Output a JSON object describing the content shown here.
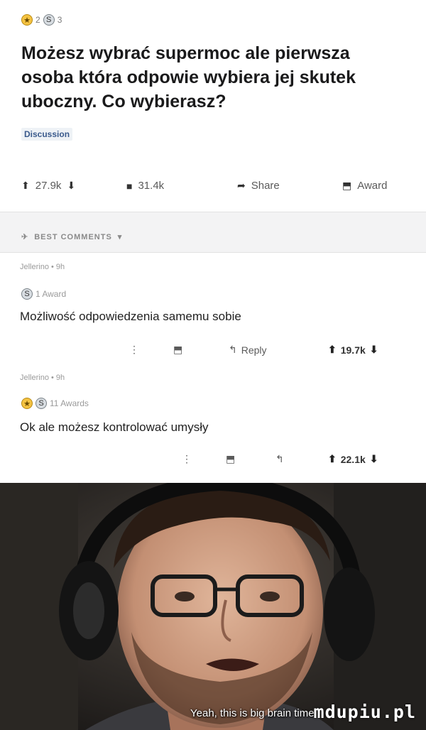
{
  "post": {
    "awards": [
      {
        "icon": "gold-award-icon",
        "count": "2"
      },
      {
        "icon": "silver-award-icon",
        "count": "3"
      }
    ],
    "title": "Możesz wybrać supermoc ale pierwsza osoba która odpowie wybiera jej skutek uboczny. Co wybierasz?",
    "flair": "Discussion",
    "actions": {
      "upvotes": "27.9k",
      "comments": "31.4k",
      "share": "Share",
      "award": "Award"
    }
  },
  "sort": {
    "label": "BEST COMMENTS"
  },
  "comments": [
    {
      "author": "Jellerino • 9h",
      "award_label": "1 Award",
      "body": "Możliwość odpowiedzenia samemu sobie",
      "reply": "Reply",
      "score": "19.7k"
    },
    {
      "author": "Jellerino • 9h",
      "award_label": "11 Awards",
      "body": "Ok ale możesz kontrolować umysły",
      "score": "22.1k"
    }
  ],
  "image": {
    "caption": "Yeah, this is big brain time.",
    "watermark": "mdupiu.pl"
  },
  "colors": {
    "gold": "#f5c342",
    "flair_text": "#3a5a8c",
    "band": "#f3f3f4"
  }
}
